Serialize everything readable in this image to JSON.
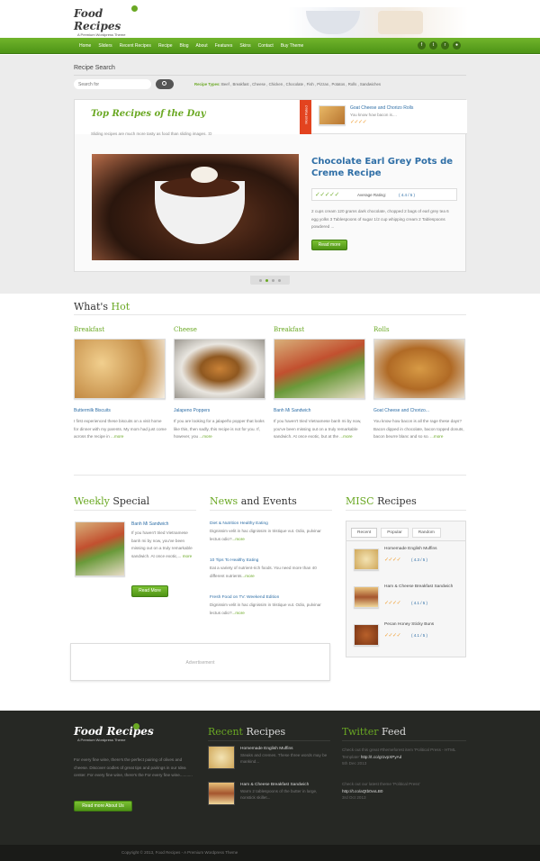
{
  "site": {
    "logo_title": "Food Recipes",
    "logo_sub": "A Premium Wordpress Theme"
  },
  "nav": {
    "items": [
      "Home",
      "Sliders",
      "Recent Recipes",
      "Recipe",
      "Blog",
      "About",
      "Features",
      "Skins",
      "Contact",
      "Buy Theme"
    ],
    "social_icons": [
      "facebook-icon",
      "twitter-icon",
      "rss-icon",
      "flickr-icon"
    ]
  },
  "search": {
    "title": "Recipe Search",
    "placeholder": "Search for",
    "types_label": "Recipe Types:",
    "types": "Beef , Breakfast , Cheese , Chicken , Chocolate , Fish , Pizzas , Potatos , Rolls , Sandwiches"
  },
  "top": {
    "title": "Top Recipes of the Day",
    "subtitle": "Sliding recipes are much more tasty as food than sliding images. :D",
    "most_rated_label": "Most Rated",
    "most_rated_title": "Goat Cheese and Chorizo Rolls",
    "most_rated_text": "You know how bacon is....",
    "feature_title": "Chocolate Earl Grey Pots de Creme Recipe",
    "rating_label": "Average Rating:",
    "rating_value": "( 4.4 / 5 )",
    "feature_text": "2 cups cream 120 grams dark chocolate, chopped 2 bags of earl grey tea 6 egg yolks 3 Tablespoons of sugar 1/2 cup whipping cream 2 Tablespoons powdered ...",
    "read_more": "Read more",
    "slider_dots": 4,
    "slider_active": 2
  },
  "whats_hot": {
    "title_a": "What's",
    "title_b": "Hot",
    "items": [
      {
        "category": "Breakfast",
        "name": "Buttermilk Biscuits",
        "text": "I first experienced these biscuits on a visit home for dinner with my parents. My mom had just come across the recipe in",
        "more": "...more"
      },
      {
        "category": "Cheese",
        "name": "Jalapeno Poppers",
        "text": "If you are looking for a jalapeño popper that looks like this, then sadly, this recipe is not for you. If, however, you",
        "more": "...more"
      },
      {
        "category": "Breakfast",
        "name": "Banh Mi Sandwich",
        "text": "If you haven't tried Vietnamese banh mi by now, you've been missing out on a truly remarkable sandwich. At once exotic, but at the",
        "more": "...more"
      },
      {
        "category": "Rolls",
        "name": "Goat Cheese and Chorizo...",
        "text": "You know how bacon is all the rage these days? Bacon dipped in chocolate, bacon topped donuts, bacon beurre blanc and so so.",
        "more": "...more"
      }
    ]
  },
  "weekly": {
    "title_a": "Weekly",
    "title_b": "Special",
    "item_title": "Banh Mi Sandwich",
    "item_text": "If you haven't tried Vietnamese banh mi by now, you've been missing out on a truly remarkable sandwich. At once exotic,...",
    "more": "more",
    "button": "Read More"
  },
  "news": {
    "title_a": "News",
    "title_b": "and Events",
    "items": [
      {
        "title": "Diet & Nutrition Healthy Eating",
        "text": "Dignissim velit in hac dignissim in tristique vut. Odio, pulvinar lectus odio?",
        "more": "...more"
      },
      {
        "title": "10 Tips To Healthy Eating",
        "text": "Eat a variety of nutrient-rich foods. You need more than 40 different nutrients",
        "more": "...more"
      },
      {
        "title": "Fresh Food on TV: Weekend Edition",
        "text": "Dignissim velit in hac dignissim in tristique vut. Odio, pulvinar lectus odio?",
        "more": "...more"
      }
    ]
  },
  "misc": {
    "title_a": "MISC",
    "title_b": "Recipes",
    "tabs": [
      "Recent",
      "Popular",
      "Random"
    ],
    "items": [
      {
        "name": "Homemade English Muffins",
        "rating": "( 4.3 / 5 )"
      },
      {
        "name": "Ham & Cheese Breakfast Sandwich",
        "rating": "( 4.1 / 5 )"
      },
      {
        "name": "Pecan Honey Sticky Buns",
        "rating": "( 4.1 / 5 )"
      }
    ]
  },
  "ad": {
    "label": "Advertisement"
  },
  "footer": {
    "logo_title": "Food Recipes",
    "logo_sub": "A Premium Wordpress Theme",
    "about_text": "For every fine wine, there's the perfect pairing of olives and cheese. Discover oodles of great tips and pairings in our Idea center. For every fine wine, there's the For every fine wine...........",
    "about_button": "Read more About Us",
    "recent_title_a": "Recent",
    "recent_title_b": "Recipes",
    "recent_items": [
      {
        "title": "Homemade English Muffins",
        "text": "Steaks and cremes. These three words may be mankind..."
      },
      {
        "title": "Ham & Cheese Breakfast Sandwich",
        "text": "Warm 2 tablespoons of the butter in large, nonstick skillet..."
      }
    ],
    "twitter_title_a": "Twitter",
    "twitter_title_b": "Feed",
    "tweets": [
      {
        "text": "Check out this great #themeforest item 'Political Press - HTML Template'",
        "link": "http://t.co/gI1vpXPyAd",
        "date": "5th Dec 2013"
      },
      {
        "text": "Check out our latest theme 'Political Press'",
        "link": "http://t.co/aQtb0vxLB0",
        "date": "3rd Oct 2013"
      }
    ],
    "copyright": "Copyright © 2013, Food Recipes - A Premium Wordpress Theme"
  },
  "colors": {
    "accent": "#6aa823",
    "nav": "#5aa51d",
    "footer": "#252722",
    "link": "#2e6ea6"
  }
}
